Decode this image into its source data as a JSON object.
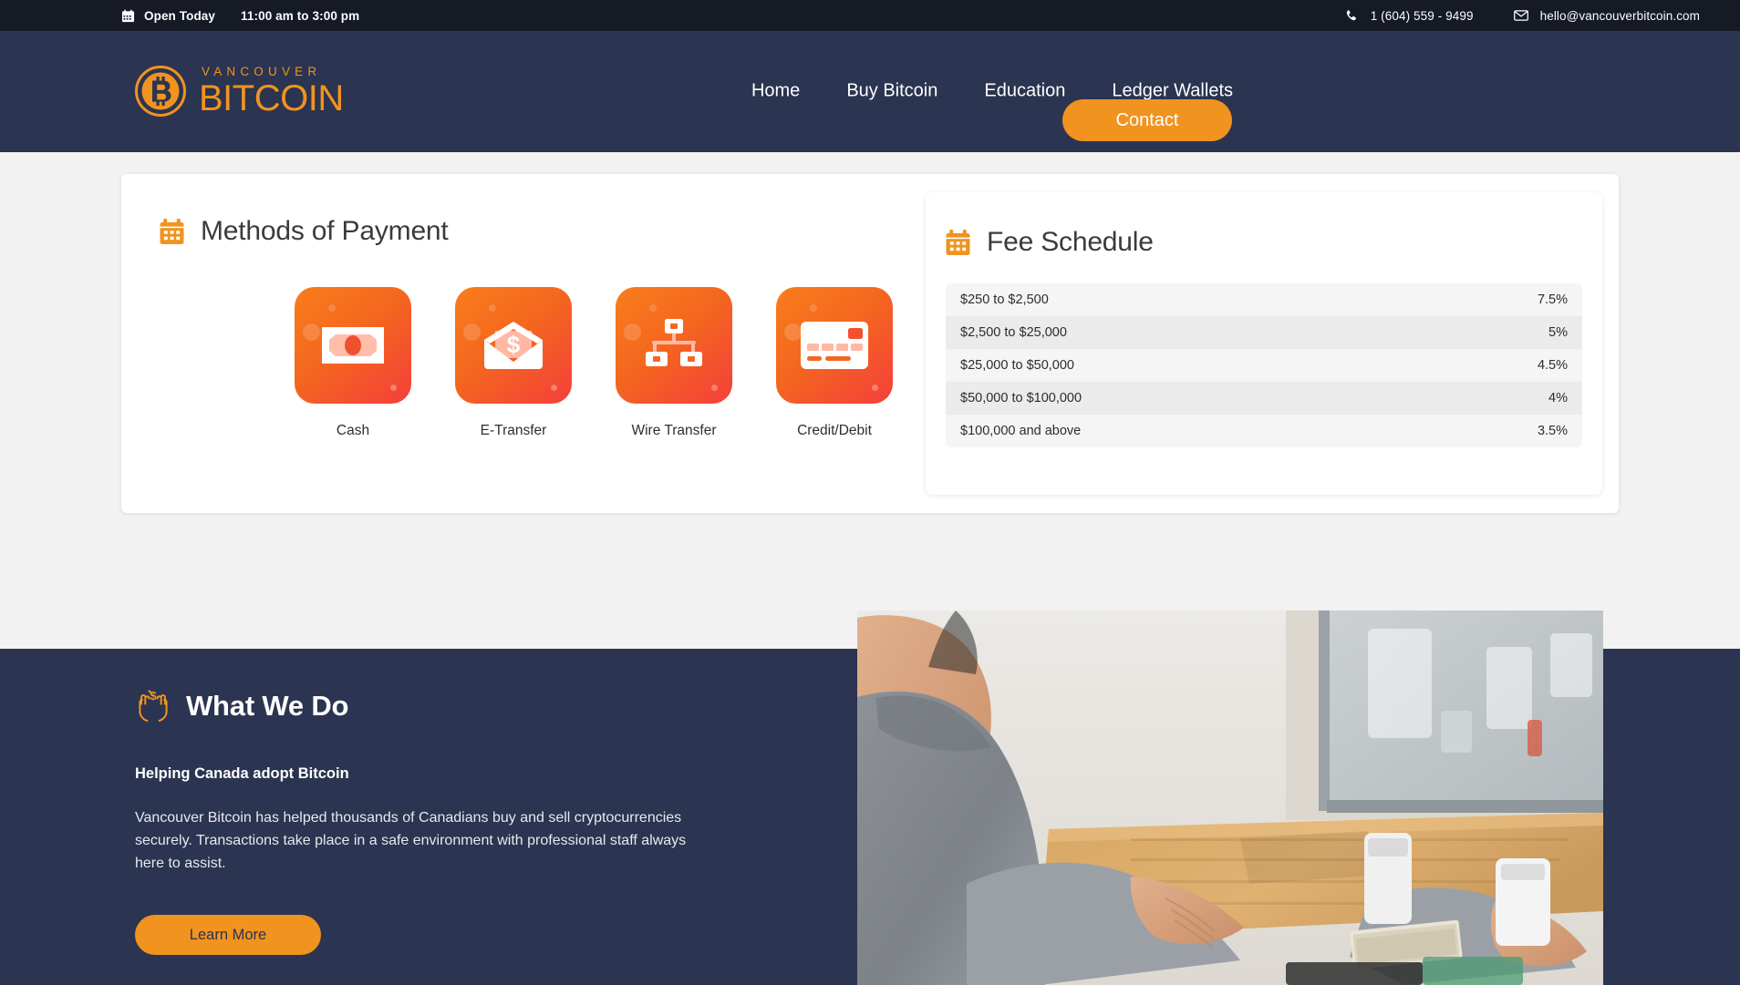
{
  "topbar": {
    "hours_label": "Open Today",
    "hours_value": "11:00 am to 3:00 pm",
    "phone": "1 (604) 559 - 9499",
    "email": "hello@vancouverbitcoin.com",
    "calendar_icon": "calendar-icon",
    "phone_icon": "phone-icon",
    "mail_icon": "envelope-icon",
    "bg_color": "#151a25"
  },
  "header": {
    "logo_top": "VANCOUVER",
    "logo_main": "BITCOIN",
    "logo_icon": "bitcoin-circle-icon",
    "nav": [
      {
        "label": "Home"
      },
      {
        "label": "Buy Bitcoin"
      },
      {
        "label": "Education"
      },
      {
        "label": "Ledger Wallets"
      }
    ],
    "contact_label": "Contact",
    "bg_color": "#2b3450",
    "accent_color": "#f0931f"
  },
  "methods_card": {
    "title": "Methods of Payment",
    "title_icon": "calendar-icon",
    "methods": [
      {
        "label": "Cash",
        "icon": "banknote-icon"
      },
      {
        "label": "E-Transfer",
        "icon": "envelope-dollar-icon"
      },
      {
        "label": "Wire Transfer",
        "icon": "network-nodes-icon"
      },
      {
        "label": "Credit/Debit",
        "icon": "credit-card-icon"
      }
    ]
  },
  "fee_card": {
    "title": "Fee Schedule",
    "title_icon": "calendar-icon",
    "rows": [
      {
        "range": "$250 to $2,500",
        "fee": "7.5%"
      },
      {
        "range": "$2,500 to $25,000",
        "fee": "5%"
      },
      {
        "range": "$25,000 to $50,000",
        "fee": "4.5%"
      },
      {
        "range": "$50,000 to $100,000",
        "fee": "4%"
      },
      {
        "range": "$100,000 and above",
        "fee": "3.5%"
      }
    ]
  },
  "what_we_do": {
    "title": "What We Do",
    "title_icon": "hands-holding-dollar-icon",
    "subtitle": "Helping Canada adopt Bitcoin",
    "body": "Vancouver Bitcoin has helped thousands of Canadians buy and sell cryptocurrencies securely. Transactions take place in a safe environment with professional staff always here to assist.",
    "button_label": "Learn More",
    "photo_alt": "customer-at-teller-window-photo"
  }
}
